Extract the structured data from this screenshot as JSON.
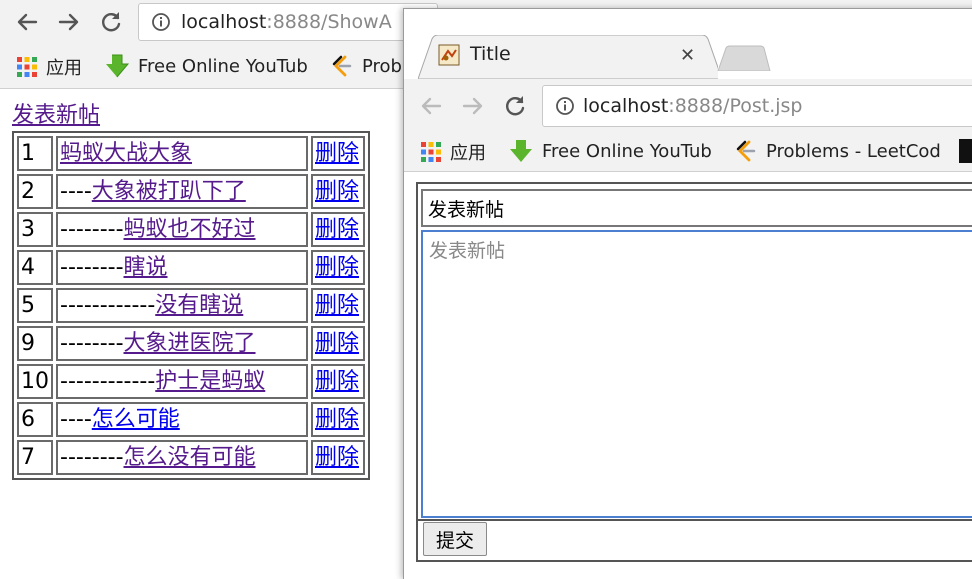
{
  "back_browser": {
    "url_host": "localhost",
    "url_rest": ":8888/ShowA",
    "bookmarks": [
      {
        "label": "应用",
        "icon": "apps-grid-icon"
      },
      {
        "label": "Free Online YouTub",
        "icon": "download-arrow-icon"
      },
      {
        "label": "Prob",
        "icon": "leetcode-icon"
      }
    ]
  },
  "forum": {
    "new_post_label": "发表新帖",
    "delete_label": "删除",
    "rows": [
      {
        "id": "1",
        "indent": "",
        "title": "蚂蚁大战大象",
        "visited": true
      },
      {
        "id": "2",
        "indent": "----",
        "title": "大象被打趴下了",
        "visited": true
      },
      {
        "id": "3",
        "indent": "--------",
        "title": "蚂蚁也不好过",
        "visited": true
      },
      {
        "id": "4",
        "indent": "--------",
        "title": "瞎说",
        "visited": true
      },
      {
        "id": "5",
        "indent": "------------",
        "title": "没有瞎说",
        "visited": true
      },
      {
        "id": "9",
        "indent": "--------",
        "title": "大象进医院了",
        "visited": true
      },
      {
        "id": "10",
        "indent": "------------",
        "title": "护士是蚂蚁",
        "visited": true
      },
      {
        "id": "6",
        "indent": "----",
        "title": "怎么可能",
        "visited": false
      },
      {
        "id": "7",
        "indent": "--------",
        "title": "怎么没有可能",
        "visited": true
      }
    ]
  },
  "front_browser": {
    "tab_title": "Title",
    "url_host": "localhost",
    "url_rest": ":8888/Post.jsp",
    "bookmarks": [
      {
        "label": "应用",
        "icon": "apps-grid-icon"
      },
      {
        "label": "Free Online YouTub",
        "icon": "download-arrow-icon"
      },
      {
        "label": "Problems - LeetCod",
        "icon": "leetcode-icon"
      }
    ],
    "form": {
      "title_value": "发表新帖",
      "content_placeholder": "发表新帖",
      "submit_label": "提交"
    }
  },
  "colors": {
    "visited_link": "#551a8b",
    "unvisited_link": "#0000ee",
    "textarea_focus": "#4d7fd1"
  }
}
